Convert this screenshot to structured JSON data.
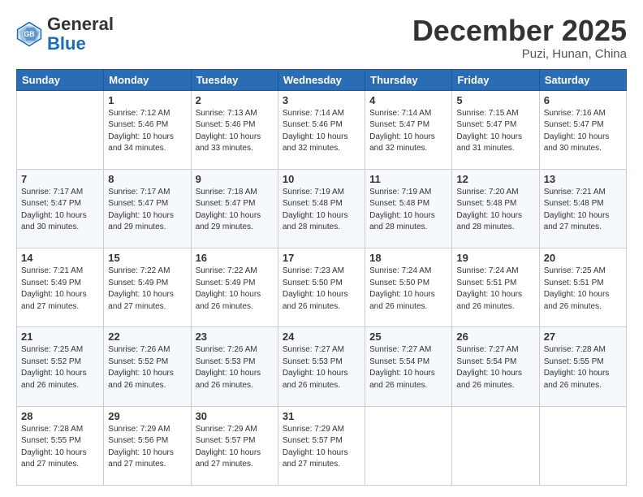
{
  "header": {
    "logo_general": "General",
    "logo_blue": "Blue",
    "month": "December 2025",
    "location": "Puzi, Hunan, China"
  },
  "days": [
    "Sunday",
    "Monday",
    "Tuesday",
    "Wednesday",
    "Thursday",
    "Friday",
    "Saturday"
  ],
  "weeks": [
    [
      {
        "date": "",
        "info": ""
      },
      {
        "date": "1",
        "info": "Sunrise: 7:12 AM\nSunset: 5:46 PM\nDaylight: 10 hours\nand 34 minutes."
      },
      {
        "date": "2",
        "info": "Sunrise: 7:13 AM\nSunset: 5:46 PM\nDaylight: 10 hours\nand 33 minutes."
      },
      {
        "date": "3",
        "info": "Sunrise: 7:14 AM\nSunset: 5:46 PM\nDaylight: 10 hours\nand 32 minutes."
      },
      {
        "date": "4",
        "info": "Sunrise: 7:14 AM\nSunset: 5:47 PM\nDaylight: 10 hours\nand 32 minutes."
      },
      {
        "date": "5",
        "info": "Sunrise: 7:15 AM\nSunset: 5:47 PM\nDaylight: 10 hours\nand 31 minutes."
      },
      {
        "date": "6",
        "info": "Sunrise: 7:16 AM\nSunset: 5:47 PM\nDaylight: 10 hours\nand 30 minutes."
      }
    ],
    [
      {
        "date": "7",
        "info": "Sunrise: 7:17 AM\nSunset: 5:47 PM\nDaylight: 10 hours\nand 30 minutes."
      },
      {
        "date": "8",
        "info": "Sunrise: 7:17 AM\nSunset: 5:47 PM\nDaylight: 10 hours\nand 29 minutes."
      },
      {
        "date": "9",
        "info": "Sunrise: 7:18 AM\nSunset: 5:47 PM\nDaylight: 10 hours\nand 29 minutes."
      },
      {
        "date": "10",
        "info": "Sunrise: 7:19 AM\nSunset: 5:48 PM\nDaylight: 10 hours\nand 28 minutes."
      },
      {
        "date": "11",
        "info": "Sunrise: 7:19 AM\nSunset: 5:48 PM\nDaylight: 10 hours\nand 28 minutes."
      },
      {
        "date": "12",
        "info": "Sunrise: 7:20 AM\nSunset: 5:48 PM\nDaylight: 10 hours\nand 28 minutes."
      },
      {
        "date": "13",
        "info": "Sunrise: 7:21 AM\nSunset: 5:48 PM\nDaylight: 10 hours\nand 27 minutes."
      }
    ],
    [
      {
        "date": "14",
        "info": "Sunrise: 7:21 AM\nSunset: 5:49 PM\nDaylight: 10 hours\nand 27 minutes."
      },
      {
        "date": "15",
        "info": "Sunrise: 7:22 AM\nSunset: 5:49 PM\nDaylight: 10 hours\nand 27 minutes."
      },
      {
        "date": "16",
        "info": "Sunrise: 7:22 AM\nSunset: 5:49 PM\nDaylight: 10 hours\nand 26 minutes."
      },
      {
        "date": "17",
        "info": "Sunrise: 7:23 AM\nSunset: 5:50 PM\nDaylight: 10 hours\nand 26 minutes."
      },
      {
        "date": "18",
        "info": "Sunrise: 7:24 AM\nSunset: 5:50 PM\nDaylight: 10 hours\nand 26 minutes."
      },
      {
        "date": "19",
        "info": "Sunrise: 7:24 AM\nSunset: 5:51 PM\nDaylight: 10 hours\nand 26 minutes."
      },
      {
        "date": "20",
        "info": "Sunrise: 7:25 AM\nSunset: 5:51 PM\nDaylight: 10 hours\nand 26 minutes."
      }
    ],
    [
      {
        "date": "21",
        "info": "Sunrise: 7:25 AM\nSunset: 5:52 PM\nDaylight: 10 hours\nand 26 minutes."
      },
      {
        "date": "22",
        "info": "Sunrise: 7:26 AM\nSunset: 5:52 PM\nDaylight: 10 hours\nand 26 minutes."
      },
      {
        "date": "23",
        "info": "Sunrise: 7:26 AM\nSunset: 5:53 PM\nDaylight: 10 hours\nand 26 minutes."
      },
      {
        "date": "24",
        "info": "Sunrise: 7:27 AM\nSunset: 5:53 PM\nDaylight: 10 hours\nand 26 minutes."
      },
      {
        "date": "25",
        "info": "Sunrise: 7:27 AM\nSunset: 5:54 PM\nDaylight: 10 hours\nand 26 minutes."
      },
      {
        "date": "26",
        "info": "Sunrise: 7:27 AM\nSunset: 5:54 PM\nDaylight: 10 hours\nand 26 minutes."
      },
      {
        "date": "27",
        "info": "Sunrise: 7:28 AM\nSunset: 5:55 PM\nDaylight: 10 hours\nand 26 minutes."
      }
    ],
    [
      {
        "date": "28",
        "info": "Sunrise: 7:28 AM\nSunset: 5:55 PM\nDaylight: 10 hours\nand 27 minutes."
      },
      {
        "date": "29",
        "info": "Sunrise: 7:29 AM\nSunset: 5:56 PM\nDaylight: 10 hours\nand 27 minutes."
      },
      {
        "date": "30",
        "info": "Sunrise: 7:29 AM\nSunset: 5:57 PM\nDaylight: 10 hours\nand 27 minutes."
      },
      {
        "date": "31",
        "info": "Sunrise: 7:29 AM\nSunset: 5:57 PM\nDaylight: 10 hours\nand 27 minutes."
      },
      {
        "date": "",
        "info": ""
      },
      {
        "date": "",
        "info": ""
      },
      {
        "date": "",
        "info": ""
      }
    ]
  ]
}
